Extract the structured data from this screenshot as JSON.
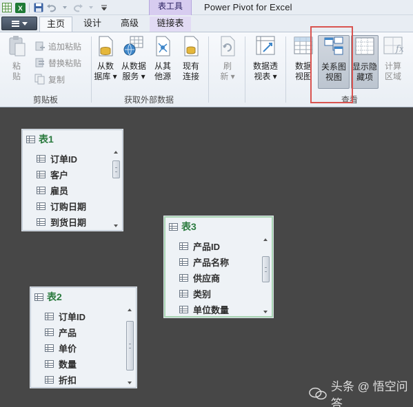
{
  "window": {
    "title": "Power Pivot for Excel",
    "context_tab_group": "表工具"
  },
  "tabs": [
    {
      "label": "主页",
      "active": true
    },
    {
      "label": "设计",
      "active": false
    },
    {
      "label": "高级",
      "active": false
    },
    {
      "label": "链接表",
      "active": false
    }
  ],
  "ribbon": {
    "clipboard": {
      "label": "剪贴板",
      "paste": "粘\n贴",
      "append_paste": "追加粘贴",
      "replace_paste": "替换粘贴",
      "copy": "复制"
    },
    "get_external": {
      "label": "获取外部数据",
      "from_db": "从数\n据库 ▾",
      "from_service": "从数据\n服务 ▾",
      "from_other": "从其\n他源",
      "existing": "现有\n连接"
    },
    "refresh": "刷\n新 ▾",
    "pivot": "数据透\n视表 ▾",
    "view": {
      "label": "查看",
      "data_view": "数据\n视图",
      "diagram_view": "关系图\n视图",
      "show_hidden": "显示隐\n藏项",
      "calc_area": "计算\n区域"
    }
  },
  "tables": [
    {
      "name": "表1",
      "fields": [
        "订单ID",
        "客户",
        "雇员",
        "订购日期",
        "到货日期"
      ]
    },
    {
      "name": "表3",
      "fields": [
        "产品ID",
        "产品名称",
        "供应商",
        "类别",
        "单位数量"
      ]
    },
    {
      "name": "表2",
      "fields": [
        "订单ID",
        "产品",
        "单价",
        "数量",
        "折扣"
      ]
    }
  ],
  "watermark": "头条 @ 悟空问答",
  "colors": {
    "canvas": "#474747",
    "table_title": "#2a7a3e",
    "highlight": "#d9534f"
  }
}
